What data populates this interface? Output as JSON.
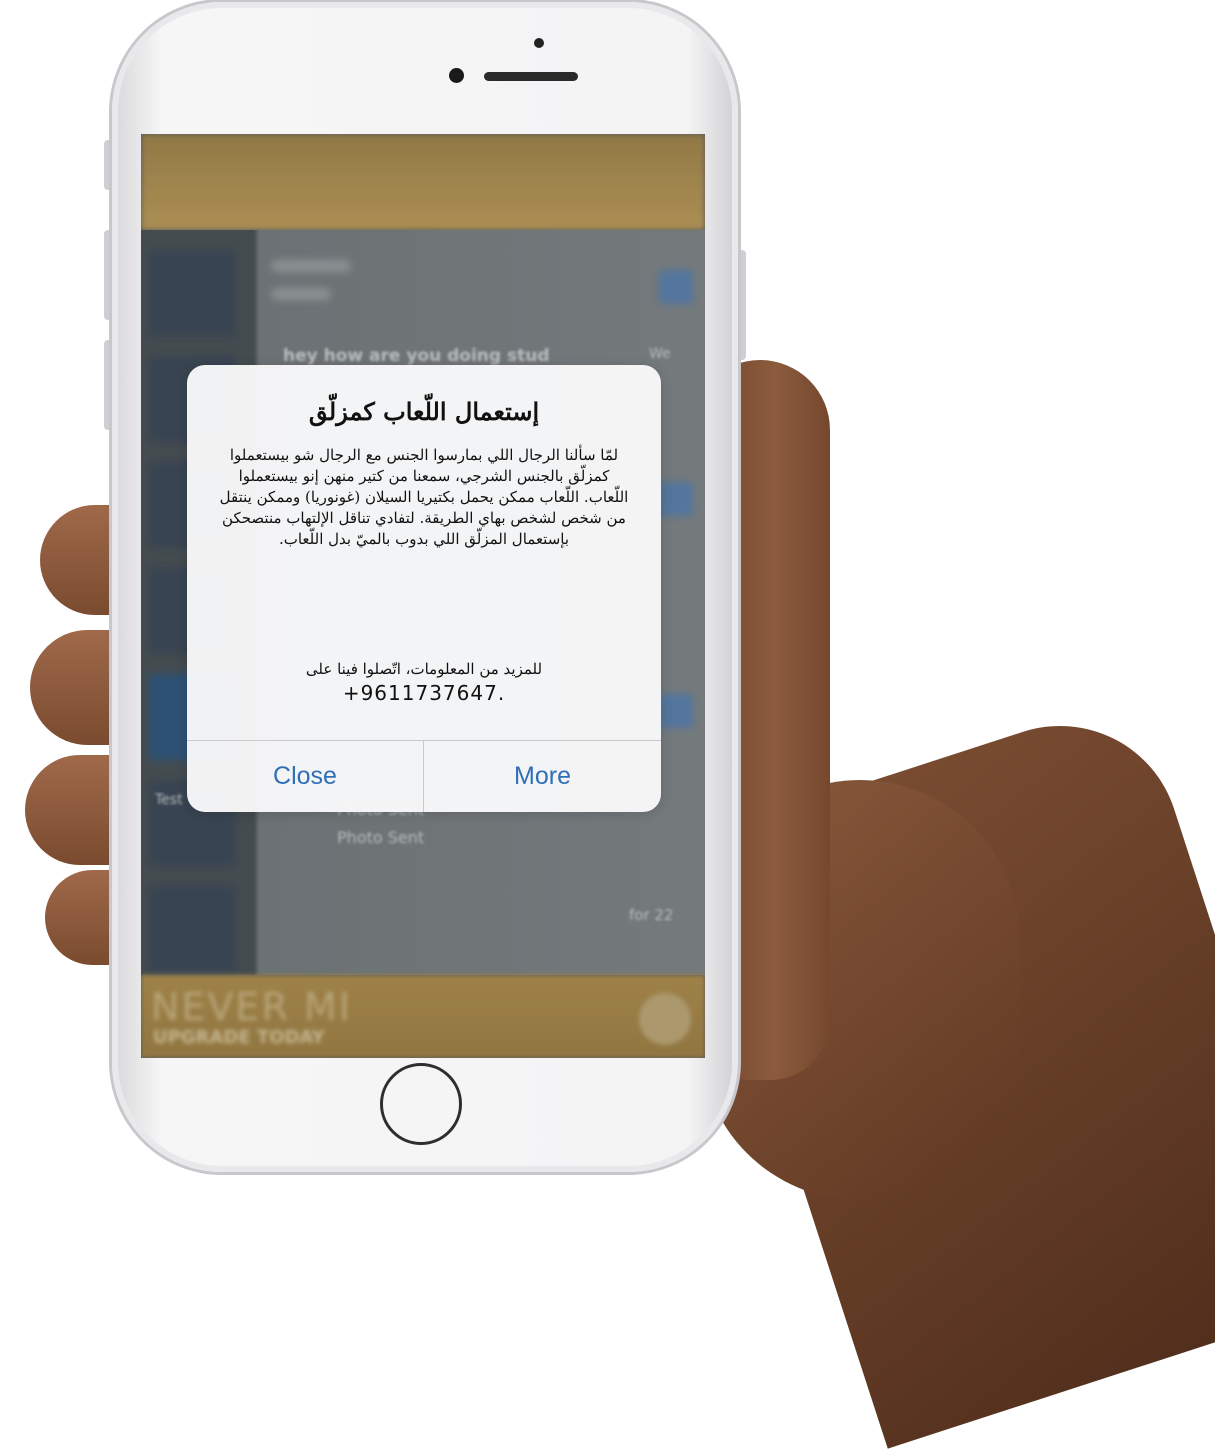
{
  "background": {
    "preview_text": "hey how are you doing stud",
    "row_items": [
      "Photo Sent",
      "Photo Sent"
    ],
    "side_label": "Test",
    "time_label": "for 22",
    "side_marker": "We",
    "upgrade_title": "NEVER MI",
    "upgrade_subtitle": "UPGRADE TODAY"
  },
  "alert": {
    "title": "إستعمال اللّعاب كمزلّق",
    "message": "لمّا سألنا الرجال اللي بمارسوا الجنس مع الرجال شو بيستعملوا كمزلّق بالجنس الشرجي، سمعنا من كتير منهن إنو بيستعملوا اللّعاب. اللّعاب ممكن يحمل بكتيريا السيلان (غونوريا) وممكن ينتقل من شخص لشخص بهاي الطريقة. لتفادي تناقل الإلتهاب منتصحكن بإستعمال المزلّق اللي بدوب بالميّ بدل اللّعاب.",
    "contact_text": "للمزيد من المعلومات، اتّصلوا فينا على",
    "phone": "+9611737647.",
    "close_label": "Close",
    "more_label": "More"
  },
  "colors": {
    "button_text": "#2f6fb8",
    "alert_bg": "#f8f8f9",
    "app_accent": "#c9a45c"
  }
}
